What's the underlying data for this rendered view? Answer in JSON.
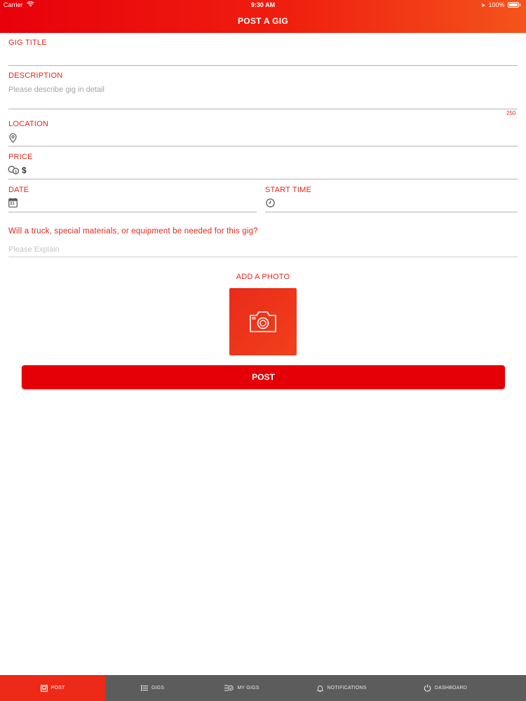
{
  "status_bar": {
    "carrier": "Carrier",
    "time": "9:30 AM",
    "battery": "100%"
  },
  "header": {
    "title": "POST A GIG"
  },
  "form": {
    "gig_title": {
      "label": "GIG TITLE",
      "value": ""
    },
    "description": {
      "label": "DESCRIPTION",
      "placeholder": "Please describe gig in detail",
      "counter": "250"
    },
    "location": {
      "label": "LOCATION",
      "icon": "map-pin-icon",
      "value": ""
    },
    "price": {
      "label": "PRICE",
      "icon": "coins-icon",
      "currency": "$",
      "value": ""
    },
    "date": {
      "label": "DATE",
      "icon": "calendar-icon",
      "icon_text": "31",
      "value": ""
    },
    "start_time": {
      "label": "START TIME",
      "icon": "clock-icon",
      "value": ""
    },
    "equipment": {
      "question": "Will a truck, special materials, or equipment be needed for this gig?",
      "placeholder": "Please Explain"
    },
    "photo": {
      "label": "ADD A PHOTO",
      "icon": "camera-icon"
    },
    "submit_label": "POST"
  },
  "tabs": [
    {
      "label": "POST",
      "icon": "post-icon",
      "active": true
    },
    {
      "label": "GIGS",
      "icon": "list-icon",
      "active": false
    },
    {
      "label": "MY GIGS",
      "icon": "my-gigs-icon",
      "active": false
    },
    {
      "label": "NOTIFICATIONS",
      "icon": "bell-icon",
      "active": false
    },
    {
      "label": "DASHBOARD",
      "icon": "power-icon",
      "active": false
    }
  ],
  "colors": {
    "accent": "#e2261b",
    "header_start": "#e8000b",
    "header_end": "#f4541c",
    "tabbar": "#5c5c5c",
    "button": "#e50008"
  }
}
